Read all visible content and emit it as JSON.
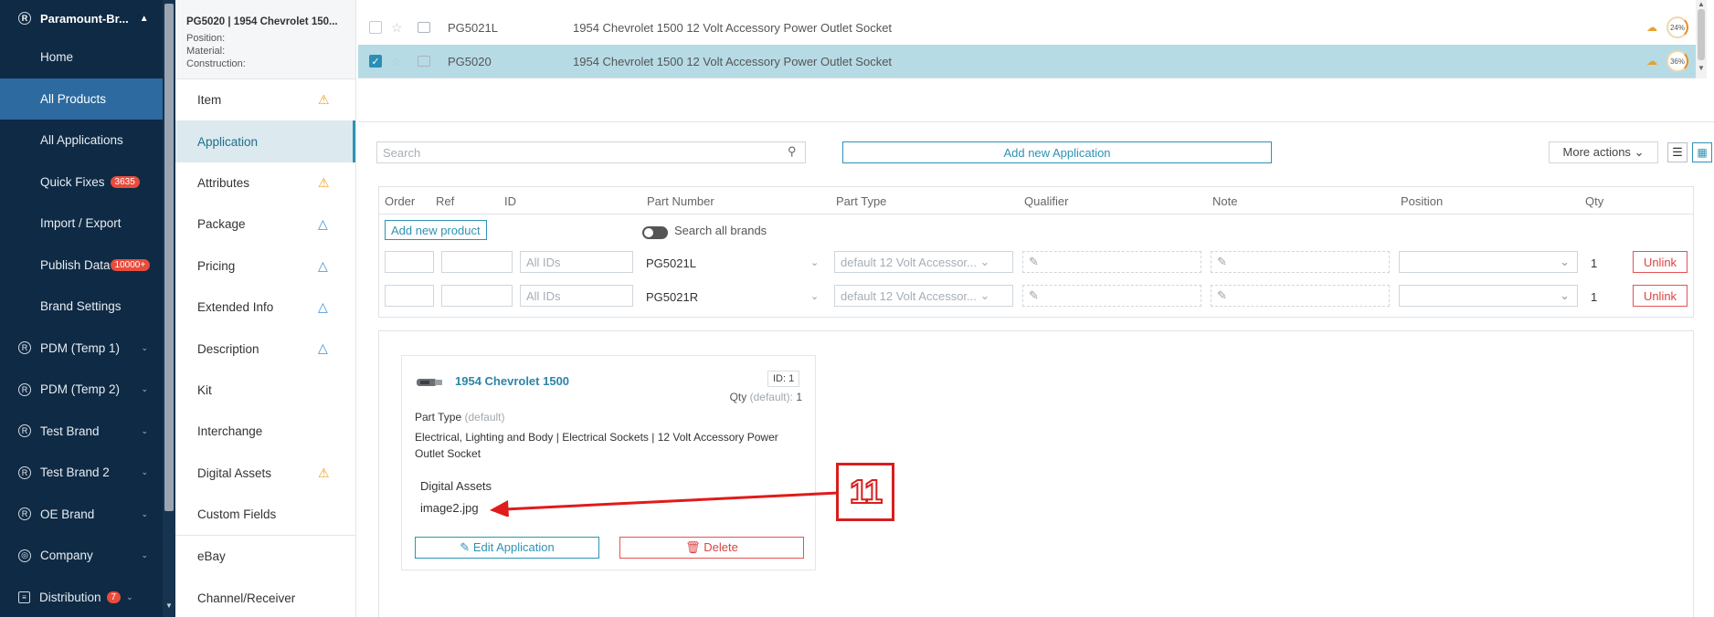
{
  "nav": {
    "brand": "Paramount-Br...",
    "reg_symbol": "R",
    "items": [
      {
        "label": "Home"
      },
      {
        "label": "All Products"
      },
      {
        "label": "All Applications"
      },
      {
        "label": "Quick Fixes",
        "badge": "3635"
      },
      {
        "label": "Import / Export"
      },
      {
        "label": "Publish Data",
        "badge": "10000+"
      },
      {
        "label": "Brand Settings"
      }
    ],
    "groups": [
      {
        "label": "PDM (Temp 1)"
      },
      {
        "label": "PDM (Temp 2)"
      },
      {
        "label": "Test Brand"
      },
      {
        "label": "Test Brand 2"
      },
      {
        "label": "OE Brand"
      },
      {
        "label": "Company"
      },
      {
        "label": "Distribution",
        "badge": "7"
      }
    ]
  },
  "product_head": {
    "title": "PG5020 | 1954 Chevrolet 150...",
    "position_label": "Position:",
    "material_label": "Material:",
    "construction_label": "Construction:"
  },
  "subnav": [
    {
      "label": "Item",
      "icon": "warning-icon"
    },
    {
      "label": "Application",
      "icon": ""
    },
    {
      "label": "Attributes",
      "icon": "warning-icon"
    },
    {
      "label": "Package",
      "icon": "info-triangle-icon"
    },
    {
      "label": "Pricing",
      "icon": "info-triangle-icon"
    },
    {
      "label": "Extended Info",
      "icon": "info-triangle-icon"
    },
    {
      "label": "Description",
      "icon": "info-triangle-icon"
    },
    {
      "label": "Kit",
      "icon": ""
    },
    {
      "label": "Interchange",
      "icon": ""
    },
    {
      "label": "Digital Assets",
      "icon": "warning-icon"
    },
    {
      "label": "Custom Fields",
      "icon": ""
    },
    {
      "label": "eBay",
      "icon": ""
    },
    {
      "label": "Channel/Receiver",
      "icon": ""
    }
  ],
  "product_rows": [
    {
      "part": "PG5021L",
      "desc": "1954 Chevrolet 1500 12 Volt Accessory Power Outlet Socket",
      "pct": "24%",
      "selected": false
    },
    {
      "part": "PG5020",
      "desc": "1954 Chevrolet 1500 12 Volt Accessory Power Outlet Socket",
      "pct": "36%",
      "selected": true
    }
  ],
  "toolbar": {
    "search_placeholder": "Search",
    "add_application": "Add new Application",
    "more_actions": "More actions"
  },
  "app_table": {
    "headers": [
      "Order",
      "Ref",
      "ID",
      "Part Number",
      "Part Type",
      "Qualifier",
      "Note",
      "Position",
      "Qty"
    ],
    "add_product": "Add new product",
    "search_all_brands": "Search all brands",
    "rows": [
      {
        "id_placeholder": "All IDs",
        "part": "PG5021L",
        "part_type": "default 12 Volt Accessor...",
        "qty": "1",
        "unlink": "Unlink"
      },
      {
        "id_placeholder": "All IDs",
        "part": "PG5021R",
        "part_type": "default 12 Volt Accessor...",
        "qty": "1",
        "unlink": "Unlink"
      }
    ]
  },
  "card": {
    "title": "1954 Chevrolet 1500",
    "id_badge": "ID: 1",
    "qty_label": "Qty",
    "qty_default": "(default):",
    "qty_value": "1",
    "part_type_label": "Part Type",
    "part_type_default": "(default)",
    "part_type_value": "Electrical, Lighting and Body | Electrical Sockets | 12 Volt Accessory Power Outlet Socket",
    "digital_assets_label": "Digital Assets",
    "digital_asset_file": "image2.jpg",
    "edit_label": "Edit Application",
    "delete_label": "Delete"
  },
  "callout": {
    "number": "11",
    "color": "#d81e1e"
  },
  "colors": {
    "nav_bg": "#0f2a44",
    "nav_active": "#2c6aa0",
    "accent": "#2d93b4",
    "selected_row": "#b6dbe5",
    "danger": "#d94444",
    "warning": "#f0a020"
  }
}
